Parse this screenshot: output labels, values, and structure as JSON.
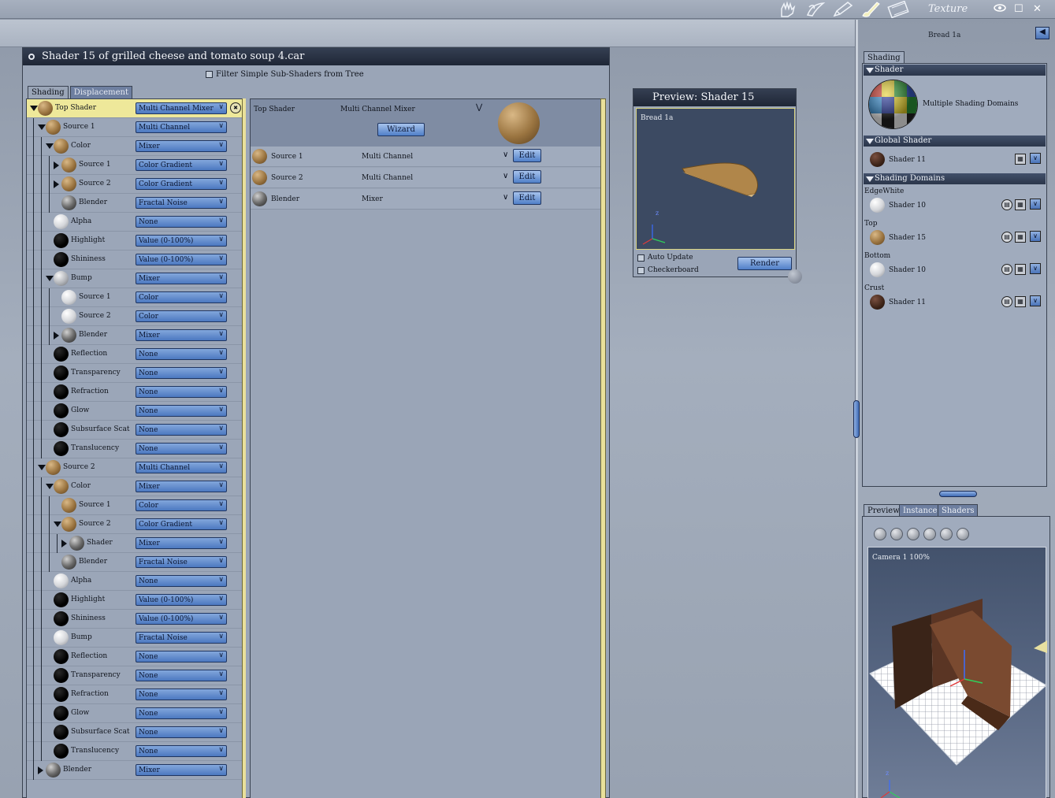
{
  "topbar": {
    "room_title": "Texture",
    "tools": [
      "hand-icon",
      "paint-icon",
      "pencil-icon",
      "brush-icon",
      "film-icon"
    ],
    "controls": [
      "eye-icon",
      "maximize-icon",
      "close-icon"
    ],
    "close_glyph": "✕",
    "max_glyph": "☐"
  },
  "shader_window": {
    "title": "Shader 15 of grilled cheese and tomato soup 4.car",
    "filter_label": "Filter Simple Sub-Shaders from Tree",
    "tabs": [
      "Shading",
      "Displacement"
    ]
  },
  "tree": [
    {
      "label": "Top Shader",
      "value": "Multi Channel Mixer",
      "indent": 0,
      "toggle": "down",
      "ball": "bread",
      "selected": true
    },
    {
      "label": "Source 1",
      "value": "Multi Channel",
      "indent": 1,
      "toggle": "down",
      "ball": "bread"
    },
    {
      "label": "Color",
      "value": "Mixer",
      "indent": 2,
      "toggle": "down",
      "ball": "bread"
    },
    {
      "label": "Source 1",
      "value": "Color Gradient",
      "indent": 3,
      "toggle": "right",
      "ball": "bread"
    },
    {
      "label": "Source 2",
      "value": "Color Gradient",
      "indent": 3,
      "toggle": "right",
      "ball": "bread"
    },
    {
      "label": "Blender",
      "value": "Fractal Noise",
      "indent": 3,
      "toggle": "",
      "ball": "noise"
    },
    {
      "label": "Alpha",
      "value": "None",
      "indent": 2,
      "toggle": "",
      "ball": "white"
    },
    {
      "label": "Highlight",
      "value": "Value (0-100%)",
      "indent": 2,
      "toggle": "",
      "ball": "black"
    },
    {
      "label": "Shininess",
      "value": "Value (0-100%)",
      "indent": 2,
      "toggle": "",
      "ball": "black"
    },
    {
      "label": "Bump",
      "value": "Mixer",
      "indent": 2,
      "toggle": "down",
      "ball": "bump"
    },
    {
      "label": "Source 1",
      "value": "Color",
      "indent": 3,
      "toggle": "",
      "ball": "white"
    },
    {
      "label": "Source 2",
      "value": "Color",
      "indent": 3,
      "toggle": "",
      "ball": "white"
    },
    {
      "label": "Blender",
      "value": "Mixer",
      "indent": 3,
      "toggle": "right",
      "ball": "noise"
    },
    {
      "label": "Reflection",
      "value": "None",
      "indent": 2,
      "toggle": "",
      "ball": "black"
    },
    {
      "label": "Transparency",
      "value": "None",
      "indent": 2,
      "toggle": "",
      "ball": "black"
    },
    {
      "label": "Refraction",
      "value": "None",
      "indent": 2,
      "toggle": "",
      "ball": "black"
    },
    {
      "label": "Glow",
      "value": "None",
      "indent": 2,
      "toggle": "",
      "ball": "black"
    },
    {
      "label": "Subsurface Scat",
      "value": "None",
      "indent": 2,
      "toggle": "",
      "ball": "black"
    },
    {
      "label": "Translucency",
      "value": "None",
      "indent": 2,
      "toggle": "",
      "ball": "black"
    },
    {
      "label": "Source 2",
      "value": "Multi Channel",
      "indent": 1,
      "toggle": "down",
      "ball": "bread"
    },
    {
      "label": "Color",
      "value": "Mixer",
      "indent": 2,
      "toggle": "down",
      "ball": "bread"
    },
    {
      "label": "Source 1",
      "value": "Color",
      "indent": 3,
      "toggle": "",
      "ball": "bread"
    },
    {
      "label": "Source 2",
      "value": "Color Gradient",
      "indent": 3,
      "toggle": "down",
      "ball": "bread"
    },
    {
      "label": "Shader",
      "value": "Mixer",
      "indent": 4,
      "toggle": "right",
      "ball": "noise"
    },
    {
      "label": "Blender",
      "value": "Fractal Noise",
      "indent": 3,
      "toggle": "",
      "ball": "noise"
    },
    {
      "label": "Alpha",
      "value": "None",
      "indent": 2,
      "toggle": "",
      "ball": "white"
    },
    {
      "label": "Highlight",
      "value": "Value (0-100%)",
      "indent": 2,
      "toggle": "",
      "ball": "black"
    },
    {
      "label": "Shininess",
      "value": "Value (0-100%)",
      "indent": 2,
      "toggle": "",
      "ball": "black"
    },
    {
      "label": "Bump",
      "value": "Fractal Noise",
      "indent": 2,
      "toggle": "",
      "ball": "white"
    },
    {
      "label": "Reflection",
      "value": "None",
      "indent": 2,
      "toggle": "",
      "ball": "black"
    },
    {
      "label": "Transparency",
      "value": "None",
      "indent": 2,
      "toggle": "",
      "ball": "black"
    },
    {
      "label": "Refraction",
      "value": "None",
      "indent": 2,
      "toggle": "",
      "ball": "black"
    },
    {
      "label": "Glow",
      "value": "None",
      "indent": 2,
      "toggle": "",
      "ball": "black"
    },
    {
      "label": "Subsurface Scat",
      "value": "None",
      "indent": 2,
      "toggle": "",
      "ball": "black"
    },
    {
      "label": "Translucency",
      "value": "None",
      "indent": 2,
      "toggle": "",
      "ball": "black"
    },
    {
      "label": "Blender",
      "value": "Mixer",
      "indent": 1,
      "toggle": "right",
      "ball": "noise"
    }
  ],
  "detail": {
    "header_label": "Top Shader",
    "header_value": "Multi Channel Mixer",
    "wizard_label": "Wizard",
    "edit_label": "Edit",
    "rows": [
      {
        "label": "Source 1",
        "value": "Multi Channel",
        "ball": "bread"
      },
      {
        "label": "Source 2",
        "value": "Multi Channel",
        "ball": "bread"
      },
      {
        "label": "Blender",
        "value": "Mixer",
        "ball": "noise"
      }
    ]
  },
  "preview": {
    "title": "Preview: Shader 15",
    "object_label": "Bread 1a",
    "auto_update_label": "Auto Update",
    "checkerboard_label": "Checkerboard",
    "render_label": "Render",
    "axis_z": "z"
  },
  "right_panel": {
    "object_name": "Bread 1a",
    "tab_shading": "Shading",
    "section_shader": "Shader",
    "shader_desc": "Multiple Shading Domains",
    "section_global": "Global Shader",
    "global_shader": "Shader 11",
    "section_domains": "Shading Domains",
    "domains": [
      {
        "name": "EdgeWhite",
        "shader": "Shader 10",
        "ball": "white"
      },
      {
        "name": "Top",
        "shader": "Shader 15",
        "ball": "bread"
      },
      {
        "name": "Bottom",
        "shader": "Shader 10",
        "ball": "white"
      },
      {
        "name": "Crust",
        "shader": "Shader 11",
        "ball": "brown"
      }
    ],
    "bottom_tabs": [
      "Preview",
      "Instances",
      "Shaders"
    ],
    "camera_label": "Camera 1 100%",
    "axis_z": "z"
  }
}
